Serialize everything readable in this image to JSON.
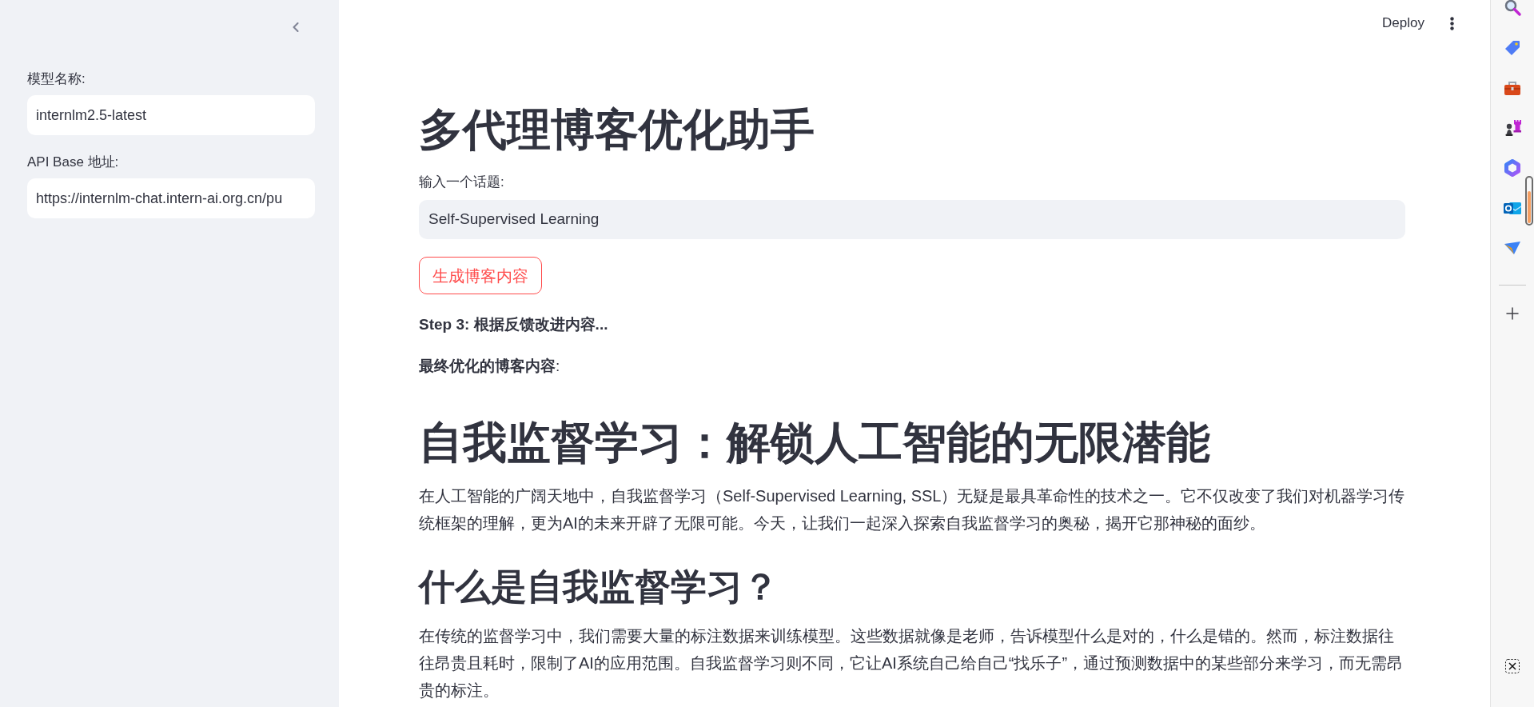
{
  "sidebar": {
    "fields": [
      {
        "label": "模型名称:",
        "value": "internlm2.5-latest"
      },
      {
        "label": "API Base 地址:",
        "value": "https://internlm-chat.intern-ai.org.cn/pu"
      }
    ]
  },
  "header": {
    "deploy_button": "Deploy"
  },
  "main": {
    "title": "多代理博客优化助手",
    "topic": {
      "label": "输入一个话题:",
      "value": "Self-Supervised Learning"
    },
    "generate_button": "生成博客内容",
    "status": "Step 3: 根据反馈改进内容...",
    "result_label": "**最终优化的博客内容**:",
    "article": [
      {
        "kind": "h1",
        "text": "自我监督学习：解锁人工智能的无限潜能"
      },
      {
        "kind": "p",
        "text": "在人工智能的广阔天地中，自我监督学习（Self-Supervised Learning, SSL）无疑是最具革命性的技术之一。它不仅改变了我们对机器学习传统框架的理解，更为AI的未来开辟了无限可能。今天，让我们一起深入探索自我监督学习的奥秘，揭开它那神秘的面纱。"
      },
      {
        "kind": "h2",
        "text": "什么是自我监督学习？"
      },
      {
        "kind": "p",
        "text": "在传统的监督学习中，我们需要大量的标注数据来训练模型。这些数据就像是老师，告诉模型什么是对的，什么是错的。然而，标注数据往往昂贵且耗时，限制了AI的应用范围。自我监督学习则不同，它让AI系统自己给自己“找乐子”，通过预测数据中的某些部分来学习，而无需昂贵的标注。"
      }
    ]
  }
}
